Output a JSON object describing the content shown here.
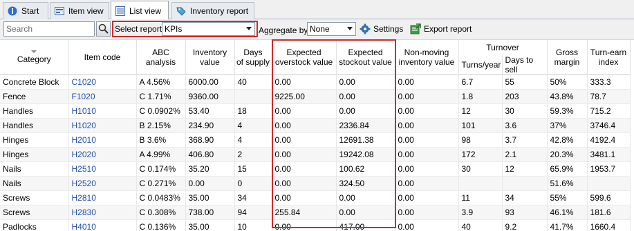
{
  "tabs": [
    {
      "label": "Start",
      "icon": "info-icon",
      "active": false
    },
    {
      "label": "Item view",
      "icon": "item-view-icon",
      "active": false
    },
    {
      "label": "List view",
      "icon": "list-view-icon",
      "active": true
    },
    {
      "label": "Inventory report",
      "icon": "tag-icon",
      "active": false
    }
  ],
  "toolbar": {
    "search_placeholder": "Search",
    "select_report_label": "Select report",
    "report_value": "KPIs",
    "aggregate_label": "Aggregate by",
    "aggregate_value": "None",
    "settings_label": "Settings",
    "export_label": "Export report"
  },
  "table": {
    "headers": {
      "category": "Category",
      "item_code": "Item code",
      "abc": [
        "ABC",
        "analysis"
      ],
      "inventory": [
        "Inventory",
        "value"
      ],
      "days": [
        "Days",
        "of supply"
      ],
      "overstock": [
        "Expected",
        "overstock value"
      ],
      "stockout": [
        "Expected",
        "stockout value"
      ],
      "nonmoving": [
        "Non-moving",
        "inventory value"
      ],
      "turnover_group": "Turnover",
      "turns": "Turns/year",
      "days_to_sell": "Days to sell",
      "gross": [
        "Gross",
        "margin"
      ],
      "turn_earn": [
        "Turn-earn",
        "index"
      ]
    },
    "rows": [
      {
        "category": "Concrete Block",
        "code": "C1020",
        "abc": "A 4.56%",
        "inv": "6000.00",
        "days": "40",
        "over": "0.00",
        "stock": "0.00",
        "nonmov": "0.00",
        "turns": "6.7",
        "dts": "55",
        "gross": "50%",
        "tei": "333.3"
      },
      {
        "category": "Fence",
        "code": "F1020",
        "abc": "C 1.71%",
        "inv": "9360.00",
        "days": "",
        "over": "9225.00",
        "stock": "0.00",
        "nonmov": "0.00",
        "turns": "1.8",
        "dts": "203",
        "gross": "43.8%",
        "tei": "78.7"
      },
      {
        "category": "Handles",
        "code": "H1010",
        "abc": "C 0.0902%",
        "inv": "53.40",
        "days": "18",
        "over": "0.00",
        "stock": "0.00",
        "nonmov": "0.00",
        "turns": "12",
        "dts": "30",
        "gross": "59.3%",
        "tei": "715.2"
      },
      {
        "category": "Handles",
        "code": "H1020",
        "abc": "B 2.15%",
        "inv": "234.90",
        "days": "4",
        "over": "0.00",
        "stock": "2336.84",
        "nonmov": "0.00",
        "turns": "101",
        "dts": "3.6",
        "gross": "37%",
        "tei": "3746.4"
      },
      {
        "category": "Hinges",
        "code": "H2010",
        "abc": "B 3.6%",
        "inv": "368.90",
        "days": "4",
        "over": "0.00",
        "stock": "12691.38",
        "nonmov": "0.00",
        "turns": "98",
        "dts": "3.7",
        "gross": "42.8%",
        "tei": "4192.4"
      },
      {
        "category": "Hinges",
        "code": "H2020",
        "abc": "A 4.99%",
        "inv": "406.80",
        "days": "2",
        "over": "0.00",
        "stock": "19242.08",
        "nonmov": "0.00",
        "turns": "172",
        "dts": "2.1",
        "gross": "20.3%",
        "tei": "3481.1"
      },
      {
        "category": "Nails",
        "code": "H2510",
        "abc": "C 0.174%",
        "inv": "35.20",
        "days": "15",
        "over": "0.00",
        "stock": "100.62",
        "nonmov": "0.00",
        "turns": "30",
        "dts": "12",
        "gross": "65.9%",
        "tei": "1953.7"
      },
      {
        "category": "Nails",
        "code": "H2520",
        "abc": "C 0.271%",
        "inv": "0.00",
        "days": "0",
        "over": "0.00",
        "stock": "324.50",
        "nonmov": "0.00",
        "turns": "",
        "dts": "",
        "gross": "51.6%",
        "tei": ""
      },
      {
        "category": "Screws",
        "code": "H2810",
        "abc": "C 0.0483%",
        "inv": "35.00",
        "days": "34",
        "over": "0.00",
        "stock": "0.00",
        "nonmov": "0.00",
        "turns": "11",
        "dts": "34",
        "gross": "55%",
        "tei": "599.6"
      },
      {
        "category": "Screws",
        "code": "H2830",
        "abc": "C 0.308%",
        "inv": "738.00",
        "days": "94",
        "over": "255.84",
        "stock": "0.00",
        "nonmov": "0.00",
        "turns": "3.9",
        "dts": "93",
        "gross": "46.1%",
        "tei": "181.6"
      },
      {
        "category": "Padlocks",
        "code": "H4010",
        "abc": "C 0.136%",
        "inv": "35.00",
        "days": "10",
        "over": "0.00",
        "stock": "417.00",
        "nonmov": "0.00",
        "turns": "40",
        "dts": "9.2",
        "gross": "41.7%",
        "tei": "1660.4"
      }
    ]
  },
  "colors": {
    "accent_red": "#d22a2a",
    "code_blue": "#1f4fa8"
  }
}
